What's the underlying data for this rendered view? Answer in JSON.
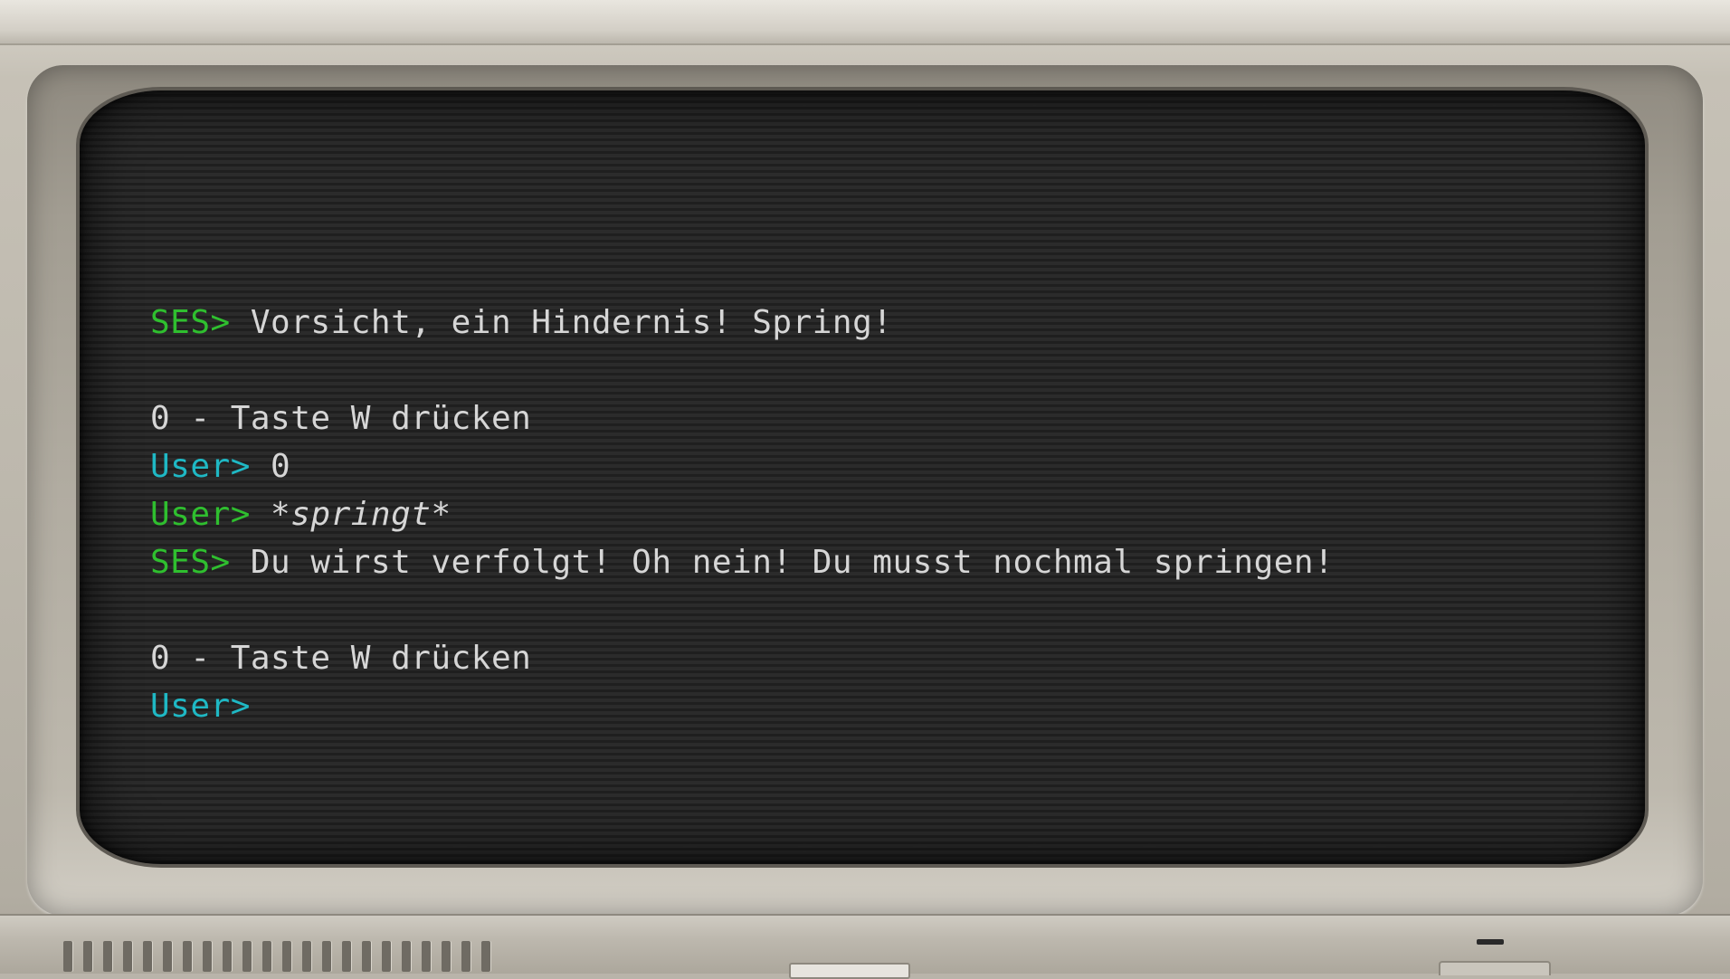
{
  "terminal": {
    "lines": [
      {
        "prompt": "SES>",
        "text": " Vorsicht, ein Hindernis! Spring!"
      },
      {
        "prompt": "",
        "text": ""
      },
      {
        "prompt": "",
        "text": "0 - Taste W drücken"
      },
      {
        "prompt": "User>",
        "text": " 0"
      },
      {
        "prompt": "User>",
        "text": " *springt*"
      },
      {
        "prompt": "SES>",
        "text": " Du wirst verfolgt! Oh nein! Du musst nochmal springen!"
      },
      {
        "prompt": "",
        "text": ""
      },
      {
        "prompt": "",
        "text": "0 - Taste W drücken"
      },
      {
        "prompt": "User>",
        "text": ""
      }
    ]
  },
  "colors": {
    "ses_prompt": "#2fbf2f",
    "user_prompt_cyan": "#1fb8c4",
    "user_prompt_green": "#2fbf2f",
    "text": "#d6d6d6",
    "screen_bg": "#2b2b2b"
  }
}
